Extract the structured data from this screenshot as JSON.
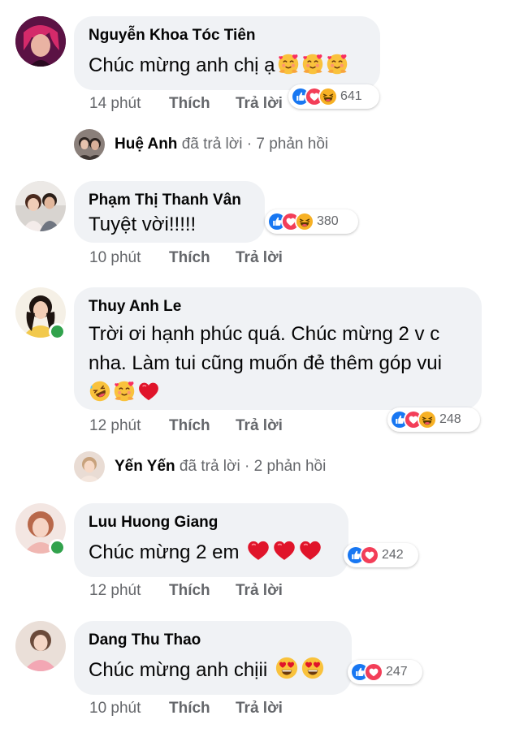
{
  "comments": [
    {
      "name": "Nguyễn Khoa Tóc Tiên",
      "text": "Chúc mừng anh chị ạ",
      "time": "14 phút",
      "like": "Thích",
      "reply": "Trả lời",
      "reactions": [
        "like",
        "love",
        "haha"
      ],
      "count": "641"
    },
    {
      "name": "Phạm Thị Thanh Vân",
      "text": "Tuyệt vời!!!!!",
      "time": "10 phút",
      "like": "Thích",
      "reply": "Trả lời",
      "reactions": [
        "like",
        "love",
        "haha"
      ],
      "count": "380"
    },
    {
      "name": "Thuy Anh Le",
      "text_line1": "Trời ơi hạnh phúc quá. Chúc mừng 2 v c",
      "text_line2": "nha. Làm tui cũng muốn đẻ thêm góp vui",
      "time": "12 phút",
      "like": "Thích",
      "reply": "Trả lời",
      "reactions": [
        "like",
        "love",
        "haha"
      ],
      "count": "248"
    },
    {
      "name": "Luu Huong Giang",
      "text": "Chúc mừng 2 em",
      "time": "12 phút",
      "like": "Thích",
      "reply": "Trả lời",
      "reactions": [
        "like",
        "love"
      ],
      "count": "242"
    },
    {
      "name": "Dang Thu Thao",
      "text": "Chúc mừng anh chịii",
      "time": "10 phút",
      "like": "Thích",
      "reply": "Trả lời",
      "reactions": [
        "like",
        "love"
      ],
      "count": "247"
    }
  ],
  "replies": [
    {
      "name": "Huệ Anh",
      "action": "đã trả lời",
      "dot": "·",
      "count": "7 phản hồi"
    },
    {
      "name": "Yến Yến",
      "action": "đã trả lời",
      "dot": "·",
      "count": "2 phản hồi"
    }
  ],
  "colors": {
    "bubble": "#f0f2f5",
    "like": "#1877f2",
    "love": "#f33e58",
    "haha": "#f7b125",
    "online": "#31a24c",
    "meta": "#65676b"
  }
}
